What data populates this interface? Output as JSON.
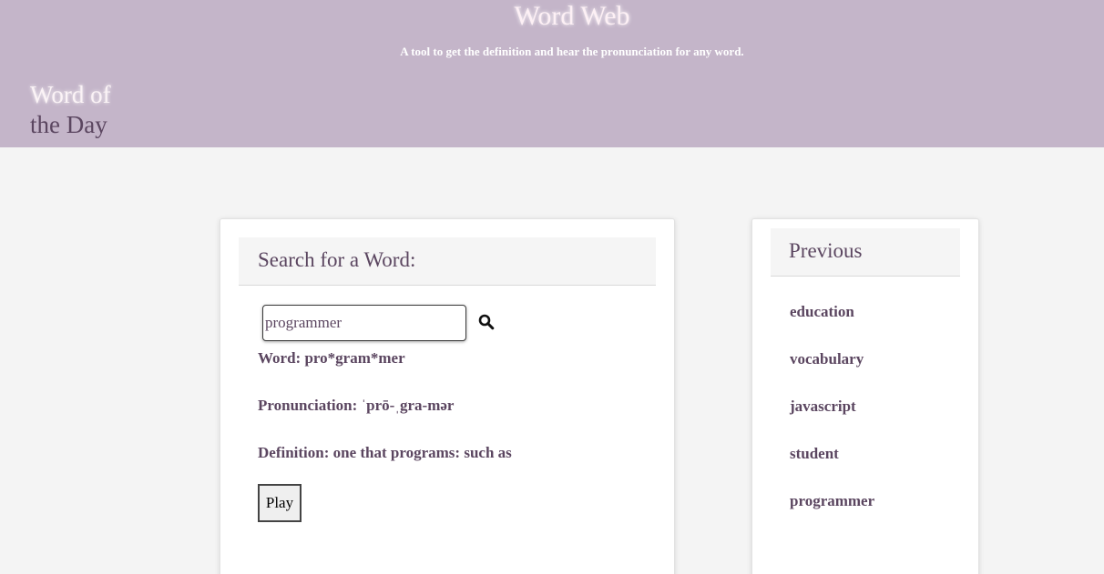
{
  "header": {
    "title": "Word Web",
    "tagline": "A tool to get the definition and hear the pronunciation for any word.",
    "word_of_day_line1": "Word of",
    "word_of_day_line2": "the Day"
  },
  "search": {
    "heading": "Search for a Word:",
    "input_value": "programmer",
    "button_icon": "search-icon",
    "word": "Word: pro*gram*mer",
    "pronunciation": "Pronunciation: ˈprō-ˌgra-mər",
    "definition": "Definition: one that programs: such as",
    "play_label": "Play"
  },
  "previous": {
    "heading": "Previous",
    "items": [
      "education",
      "vocabulary",
      "javascript",
      "student",
      "programmer"
    ]
  },
  "colors": {
    "header_bg": "#c4b5c9",
    "page_bg": "#f4f4f4",
    "text": "#5b4660"
  }
}
